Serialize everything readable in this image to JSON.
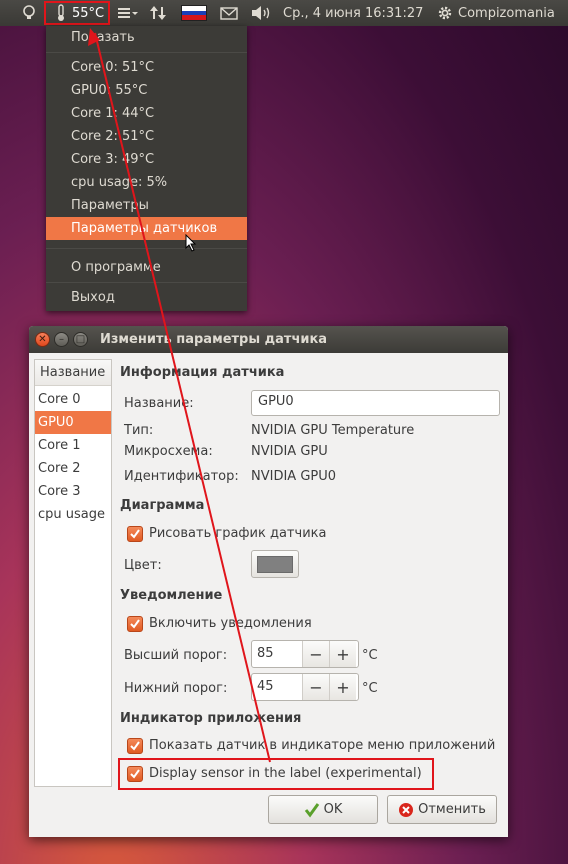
{
  "panel": {
    "temperature": "55°C",
    "date_time": "Ср., 4 июня 16:31:27",
    "user": "Compizomania"
  },
  "menu": {
    "items": [
      "Показать",
      "Core 0: 51°C",
      "GPU0: 55°C",
      "Core 1: 44°C",
      "Core 2: 51°C",
      "Core 3: 49°C",
      "cpu usage: 5%",
      "Параметры",
      "Параметры датчиков",
      "О программе",
      "Выход"
    ],
    "active_index": 8
  },
  "dialog": {
    "title": "Изменить параметры датчика",
    "list_header": "Название",
    "sensors": [
      "Core 0",
      "GPU0",
      "Core 1",
      "Core 2",
      "Core 3",
      "cpu usage"
    ],
    "selected_sensor": "GPU0",
    "info": {
      "section": "Информация датчика",
      "name_label": "Название:",
      "name_value": "GPU0",
      "type_label": "Тип:",
      "type_value": "NVIDIA GPU Temperature",
      "chip_label": "Микросхема:",
      "chip_value": "NVIDIA GPU",
      "id_label": "Идентификатор:",
      "id_value": "NVIDIA GPU0"
    },
    "graph": {
      "section": "Диаграмма",
      "draw_label": "Рисовать график датчика",
      "draw_checked": true,
      "color_label": "Цвет:",
      "color_value": "#808080"
    },
    "alarm": {
      "section": "Уведомление",
      "enable_label": "Включить уведомления",
      "enable_checked": true,
      "high_label": "Высший порог:",
      "high_value": "85",
      "low_label": "Нижний порог:",
      "low_value": "45",
      "unit": "°C"
    },
    "indicator": {
      "section": "Индикатор приложения",
      "show_label": "Показать датчик в индикаторе меню приложений",
      "show_checked": true,
      "label_label": "Display sensor in the label (experimental)",
      "label_checked": true
    },
    "ok_label": "OK",
    "cancel_label": "Отменить"
  },
  "colors": {
    "accent": "#f07746",
    "highlight_red": "#e0151b"
  }
}
